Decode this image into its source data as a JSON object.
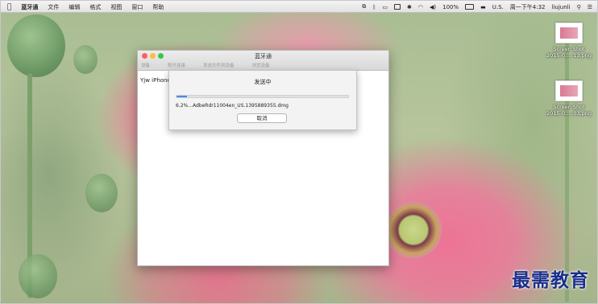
{
  "menubar": {
    "apple_icon": "apple-icon",
    "app_name": "蓝牙通",
    "menus": [
      "文件",
      "编辑",
      "格式",
      "视图",
      "窗口",
      "帮助"
    ],
    "status": {
      "battery": "100%",
      "input_source": "U.S.",
      "datetime": "周一下午4:32",
      "user": "liujunli"
    }
  },
  "desktop": {
    "icons": [
      {
        "line1": "Screen Shot",
        "line2": "2015-0.....13.png"
      },
      {
        "line1": "Screen Shot",
        "line2": "2015-0.....03.png"
      }
    ]
  },
  "window": {
    "title": "蓝牙通",
    "traffic_lights": {
      "close": "#fc605c",
      "minimize": "#fdbc40",
      "zoom": "#34c84a"
    },
    "tabs": [
      "设备",
      "断开连接",
      "发送文件到设备",
      "浏览设备"
    ],
    "device_name": "Yjw iPhone"
  },
  "sheet": {
    "title": "发送中",
    "progress": 0.062,
    "progress_text": "6.2%...AdbeRdr11004en_US.1395889355.dmg",
    "cancel_label": "取消"
  },
  "watermark": "最需教育",
  "colors": {
    "accent": "#3d8ff0",
    "watermark": "#1a2f8a"
  }
}
